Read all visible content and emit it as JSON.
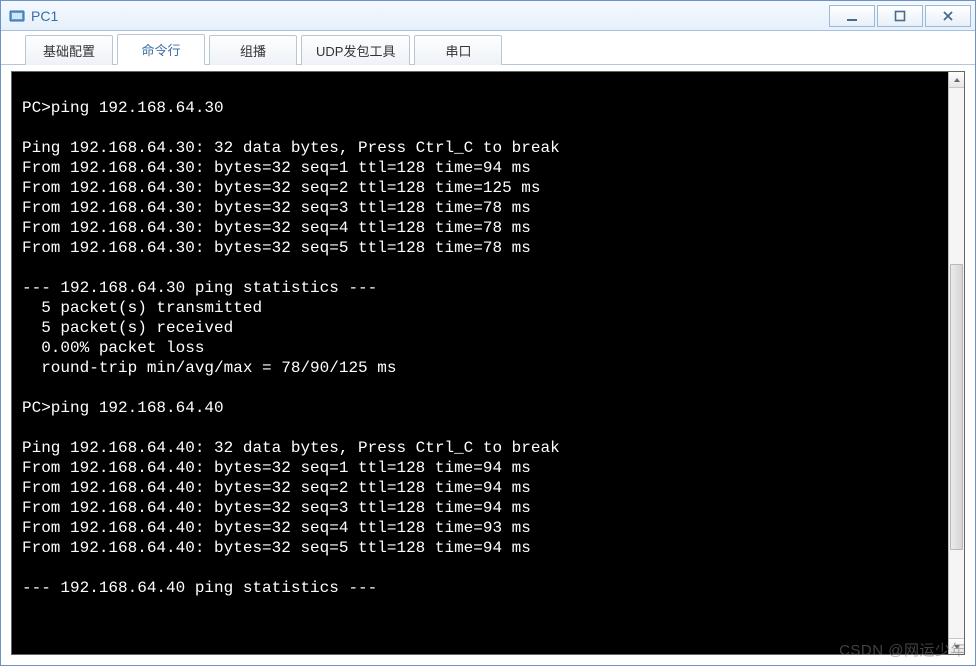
{
  "window": {
    "title": "PC1",
    "icon_name": "app-icon",
    "buttons": {
      "minimize": "minimize",
      "maximize": "maximize",
      "close": "close"
    }
  },
  "tabs": [
    {
      "label": "基础配置",
      "active": false
    },
    {
      "label": "命令行",
      "active": true
    },
    {
      "label": "组播",
      "active": false
    },
    {
      "label": "UDP发包工具",
      "active": false
    },
    {
      "label": "串口",
      "active": false
    }
  ],
  "terminal": {
    "lines": [
      "",
      "PC>ping 192.168.64.30",
      "",
      "Ping 192.168.64.30: 32 data bytes, Press Ctrl_C to break",
      "From 192.168.64.30: bytes=32 seq=1 ttl=128 time=94 ms",
      "From 192.168.64.30: bytes=32 seq=2 ttl=128 time=125 ms",
      "From 192.168.64.30: bytes=32 seq=3 ttl=128 time=78 ms",
      "From 192.168.64.30: bytes=32 seq=4 ttl=128 time=78 ms",
      "From 192.168.64.30: bytes=32 seq=5 ttl=128 time=78 ms",
      "",
      "--- 192.168.64.30 ping statistics ---",
      "  5 packet(s) transmitted",
      "  5 packet(s) received",
      "  0.00% packet loss",
      "  round-trip min/avg/max = 78/90/125 ms",
      "",
      "PC>ping 192.168.64.40",
      "",
      "Ping 192.168.64.40: 32 data bytes, Press Ctrl_C to break",
      "From 192.168.64.40: bytes=32 seq=1 ttl=128 time=94 ms",
      "From 192.168.64.40: bytes=32 seq=2 ttl=128 time=94 ms",
      "From 192.168.64.40: bytes=32 seq=3 ttl=128 time=94 ms",
      "From 192.168.64.40: bytes=32 seq=4 ttl=128 time=93 ms",
      "From 192.168.64.40: bytes=32 seq=5 ttl=128 time=94 ms",
      "",
      "--- 192.168.64.40 ping statistics ---"
    ]
  },
  "scrollbar": {
    "thumb_top_pct": 32,
    "thumb_height_pct": 52
  },
  "watermark": "CSDN @网运少年"
}
